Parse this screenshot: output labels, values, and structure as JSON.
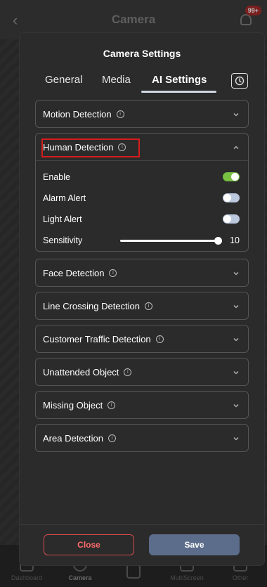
{
  "background": {
    "title": "Camera",
    "badge": "99+",
    "nav": [
      "Dashboard",
      "Camera",
      "",
      "MultiScreen",
      "Other"
    ]
  },
  "modal": {
    "title": "Camera Settings",
    "tabs": [
      {
        "label": "General",
        "active": false
      },
      {
        "label": "Media",
        "active": false
      },
      {
        "label": "AI Settings",
        "active": true
      }
    ],
    "history_icon": "history-clock-icon",
    "sections": [
      {
        "label": "Motion Detection",
        "expanded": false
      },
      {
        "label": "Human Detection",
        "expanded": true,
        "highlighted": true
      },
      {
        "label": "Face Detection",
        "expanded": false
      },
      {
        "label": "Line Crossing Detection",
        "expanded": false
      },
      {
        "label": "Customer Traffic Detection",
        "expanded": false
      },
      {
        "label": "Unattended Object",
        "expanded": false
      },
      {
        "label": "Missing Object",
        "expanded": false
      },
      {
        "label": "Area Detection",
        "expanded": false
      }
    ],
    "human_detection": {
      "enable_label": "Enable",
      "enable_on": true,
      "alarm_label": "Alarm Alert",
      "alarm_on": false,
      "light_label": "Light Alert",
      "light_on": false,
      "sensitivity_label": "Sensitivity",
      "sensitivity_value": "10",
      "sensitivity_max": 10
    },
    "buttons": {
      "close": "Close",
      "save": "Save"
    }
  },
  "colors": {
    "toggle_on": "#78c143",
    "toggle_off": "#bcc8dd",
    "highlight": "#d71c1c",
    "save_bg": "#5b6d8a",
    "close_border": "#d84a4a"
  }
}
